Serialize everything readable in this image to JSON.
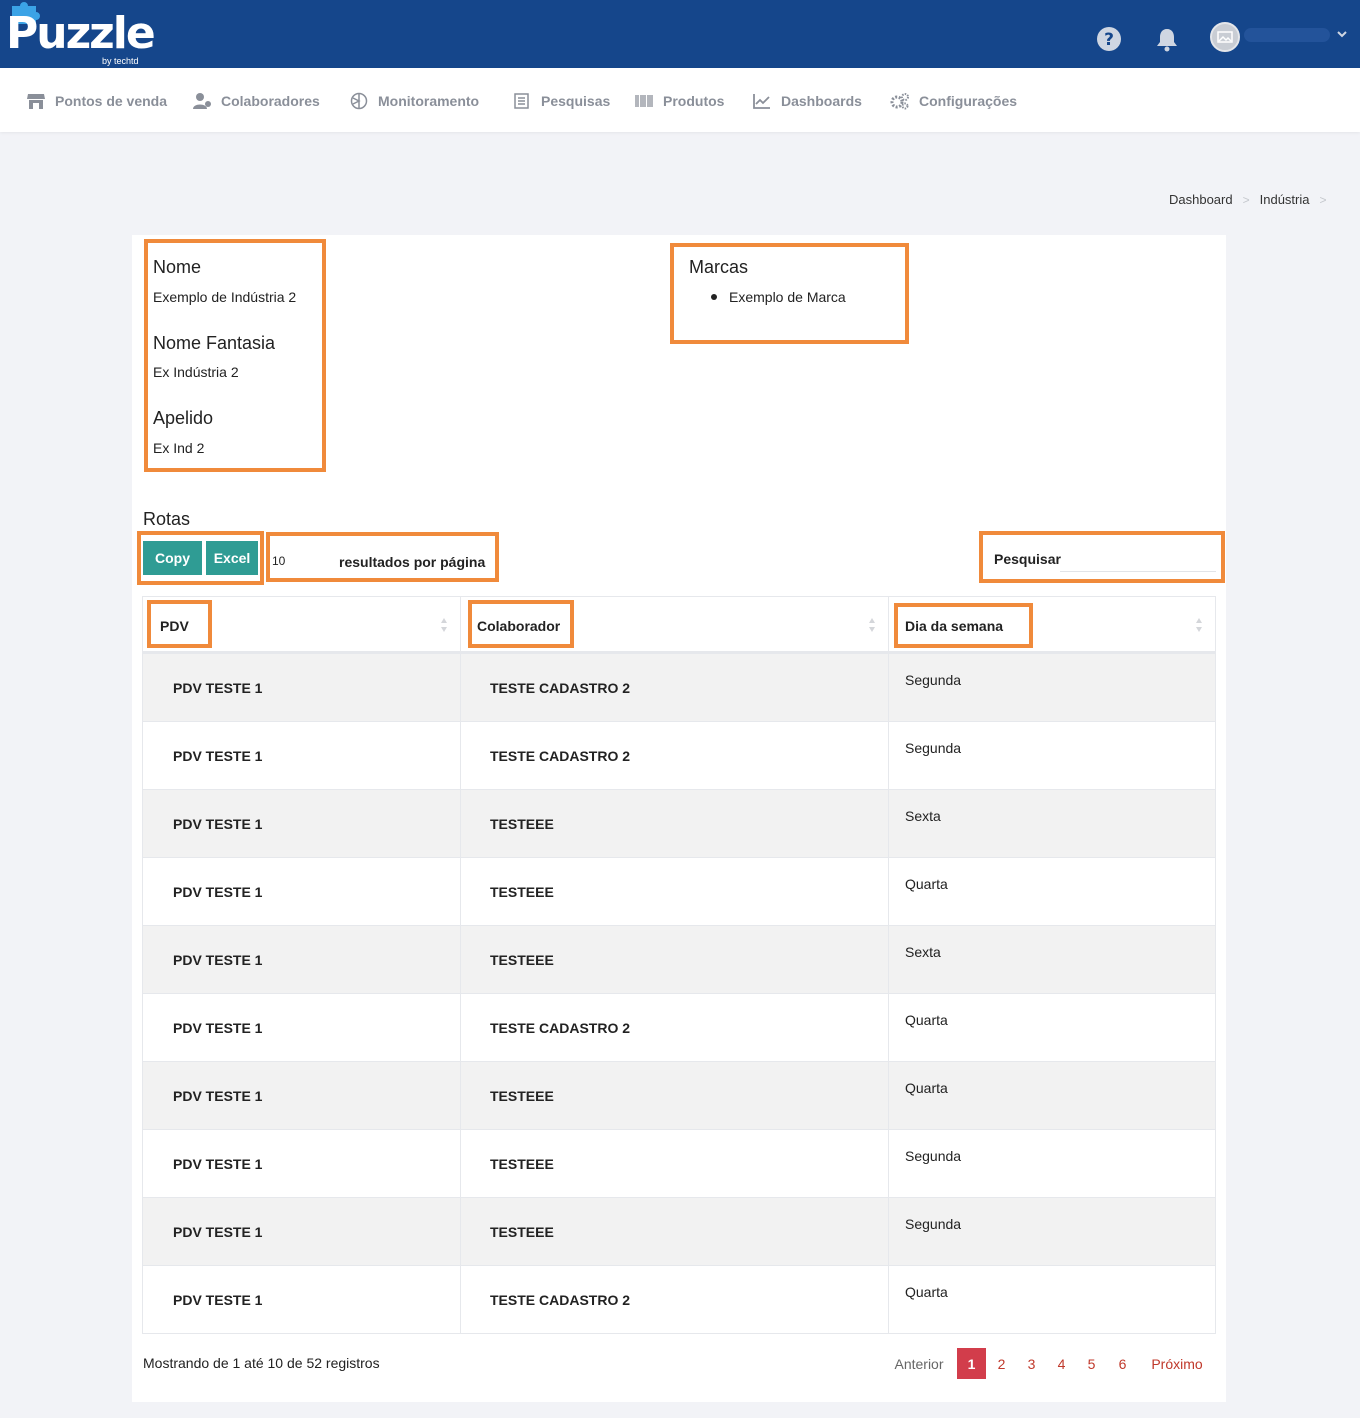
{
  "header": {
    "logo_text": "Puzzle",
    "logo_sub": "by techtd",
    "icons": [
      "help-icon",
      "bell-icon",
      "avatar",
      "chevron-down-icon"
    ]
  },
  "nav": {
    "items": [
      {
        "label": "Pontos de venda",
        "icon": "store-icon"
      },
      {
        "label": "Colaboradores",
        "icon": "users-icon"
      },
      {
        "label": "Monitoramento",
        "icon": "compass-icon"
      },
      {
        "label": "Pesquisas",
        "icon": "survey-icon"
      },
      {
        "label": "Produtos",
        "icon": "barcode-icon"
      },
      {
        "label": "Dashboards",
        "icon": "chart-icon"
      },
      {
        "label": "Configurações",
        "icon": "gears-icon"
      }
    ]
  },
  "breadcrumb": {
    "items": [
      "Dashboard",
      "Indústria"
    ],
    "separator": ">"
  },
  "details": {
    "nome_label": "Nome",
    "nome_value": "Exemplo de Indústria 2",
    "fantasia_label": "Nome Fantasia",
    "fantasia_value": "Ex Indústria 2",
    "apelido_label": "Apelido",
    "apelido_value": "Ex Ind 2",
    "marcas_label": "Marcas",
    "marcas": [
      "Exemplo de Marca"
    ]
  },
  "rotas": {
    "title": "Rotas",
    "copy_label": "Copy",
    "excel_label": "Excel",
    "page_length": "10",
    "page_length_label": "resultados por página",
    "search_label": "Pesquisar",
    "search_value": "",
    "columns": [
      "PDV",
      "Colaborador",
      "Dia da semana"
    ],
    "rows": [
      {
        "pdv": "PDV TESTE 1",
        "colaborador": "TESTE CADASTRO 2",
        "dia": "Segunda"
      },
      {
        "pdv": "PDV TESTE 1",
        "colaborador": "TESTE CADASTRO 2",
        "dia": "Segunda"
      },
      {
        "pdv": "PDV TESTE 1",
        "colaborador": "TESTEEE",
        "dia": "Sexta"
      },
      {
        "pdv": "PDV TESTE 1",
        "colaborador": "TESTEEE",
        "dia": "Quarta"
      },
      {
        "pdv": "PDV TESTE 1",
        "colaborador": "TESTEEE",
        "dia": "Sexta"
      },
      {
        "pdv": "PDV TESTE 1",
        "colaborador": "TESTE CADASTRO 2",
        "dia": "Quarta"
      },
      {
        "pdv": "PDV TESTE 1",
        "colaborador": "TESTEEE",
        "dia": "Quarta"
      },
      {
        "pdv": "PDV TESTE 1",
        "colaborador": "TESTEEE",
        "dia": "Segunda"
      },
      {
        "pdv": "PDV TESTE 1",
        "colaborador": "TESTEEE",
        "dia": "Segunda"
      },
      {
        "pdv": "PDV TESTE 1",
        "colaborador": "TESTE CADASTRO 2",
        "dia": "Quarta"
      }
    ],
    "info": "Mostrando de 1 até 10 de 52 registros",
    "pagination": {
      "previous": "Anterior",
      "pages": [
        "1",
        "2",
        "3",
        "4",
        "5",
        "6"
      ],
      "current": "1",
      "next": "Próximo"
    }
  },
  "colors": {
    "header_bg": "#15468b",
    "accent_button": "#2f9c94",
    "highlight_border": "#f08a3b",
    "pagination_active": "#d23d4b",
    "pagination_link": "#c0392b"
  }
}
